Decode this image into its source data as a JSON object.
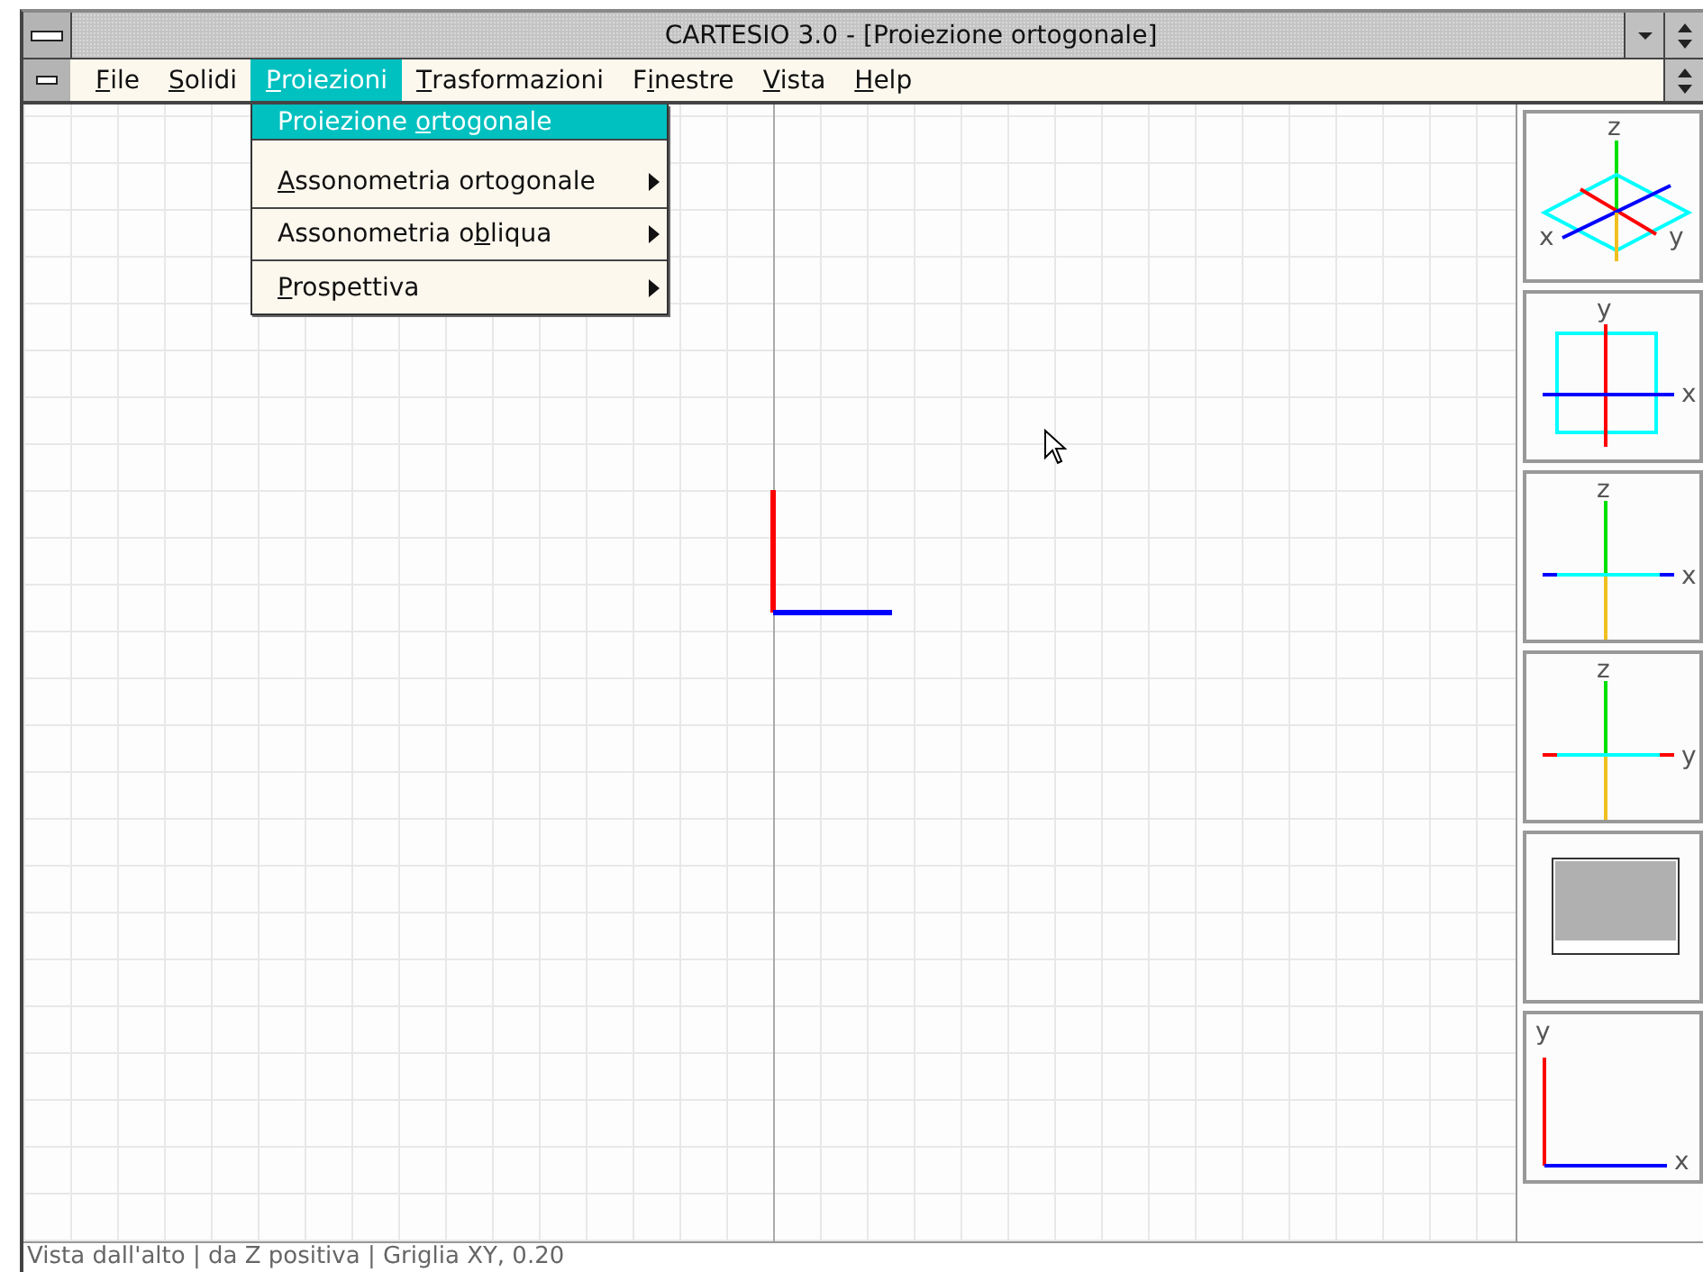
{
  "window": {
    "title": "CARTESIO 3.0 - [Proiezione ortogonale]"
  },
  "menu_bar": [
    {
      "label": {
        "key": "F",
        "after": "ile"
      },
      "selected": false
    },
    {
      "label": {
        "key": "S",
        "after": "olidi"
      },
      "selected": false
    },
    {
      "label": {
        "key": "P",
        "after": "roiezioni"
      },
      "selected": true
    },
    {
      "label": {
        "key": "T",
        "after": "rasformazioni"
      },
      "selected": false
    },
    {
      "label": {
        "before": "F",
        "key": "i",
        "after": "nestre"
      },
      "selected": false
    },
    {
      "label": {
        "key": "V",
        "after": "ista"
      },
      "selected": false
    },
    {
      "label": {
        "key": "H",
        "after": "elp"
      },
      "selected": false
    }
  ],
  "dropdown": [
    {
      "label": {
        "before": "Proiezione ",
        "key": "o",
        "after": "rtogonale"
      },
      "selected": true,
      "submenu": false
    },
    {
      "label": {
        "key": "A",
        "after": "ssonometria ortogonale"
      },
      "selected": false,
      "submenu": true
    },
    {
      "label": {
        "before": "Assonometria o",
        "key": "b",
        "after": "liqua"
      },
      "selected": false,
      "submenu": true
    },
    {
      "label": {
        "key": "P",
        "after": "rospettiva"
      },
      "selected": false,
      "submenu": true
    }
  ],
  "thumbnails": [
    {
      "kind": "iso",
      "labels": [
        "z",
        "x",
        "y"
      ]
    },
    {
      "kind": "top",
      "labels": [
        "y",
        "x"
      ]
    },
    {
      "kind": "front",
      "labels": [
        "z",
        "x"
      ]
    },
    {
      "kind": "side",
      "labels": [
        "z",
        "y"
      ]
    },
    {
      "kind": "shade"
    },
    {
      "kind": "plane",
      "labels": [
        "y",
        "x"
      ]
    }
  ],
  "status_bar": "Vista dall'alto | da Z positiva | Griglia XY, 0.20"
}
